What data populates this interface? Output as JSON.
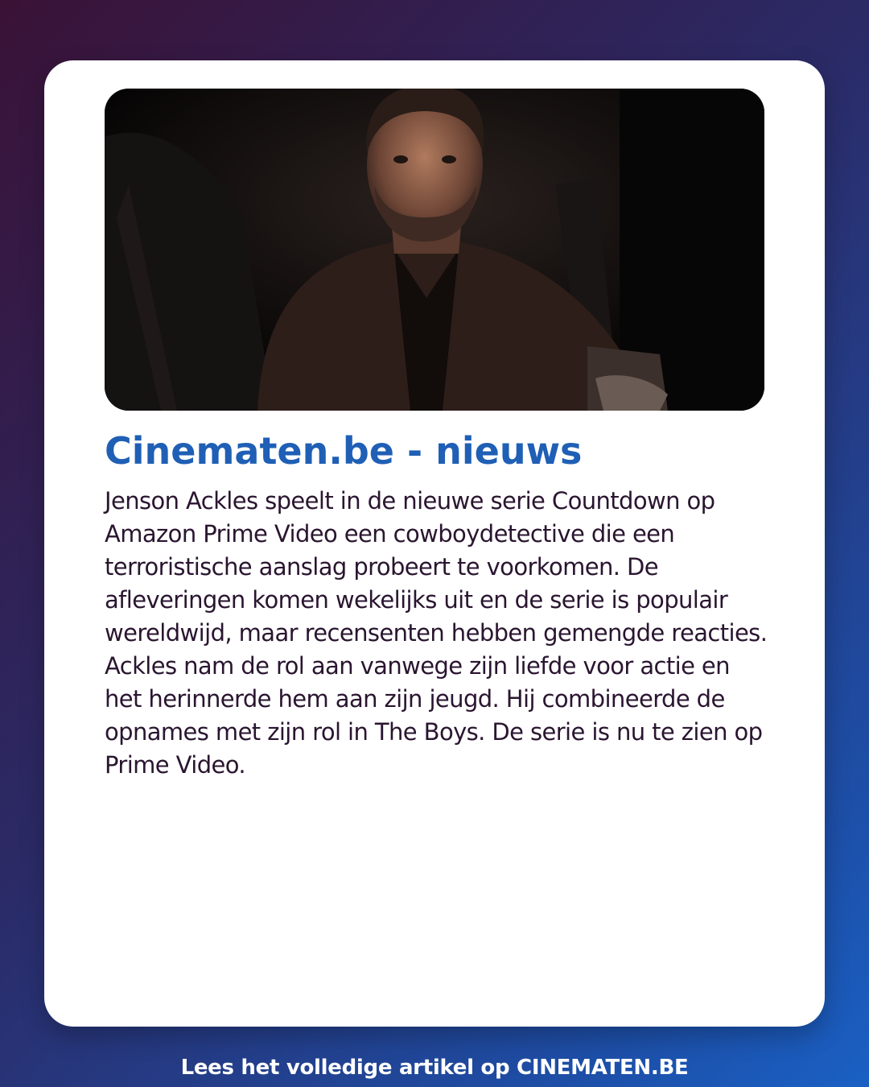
{
  "article": {
    "photo_alt": "",
    "headline": "Cinematen.be - nieuws",
    "body": "Jenson Ackles speelt in de nieuwe serie Countdown op Amazon Prime Video een cowboydetective die een terroristische aanslag probeert te voorkomen. De afleveringen komen wekelijks uit en de serie is populair wereldwijd, maar recensenten hebben gemengde reacties. Ackles nam de rol aan vanwege zijn liefde voor actie en het herinnerde hem aan zijn jeugd. Hij combineerde de opnames met zijn rol in The Boys. De serie is nu te zien op Prime Video."
  },
  "footer": {
    "cta": "Lees het volledige artikel op CINEMATEN.BE"
  },
  "colors": {
    "headline": "#1f5fb5",
    "body_text": "#2a1530",
    "card_bg": "#ffffff",
    "bg_start": "#3a1236",
    "bg_end": "#1a60c4"
  }
}
